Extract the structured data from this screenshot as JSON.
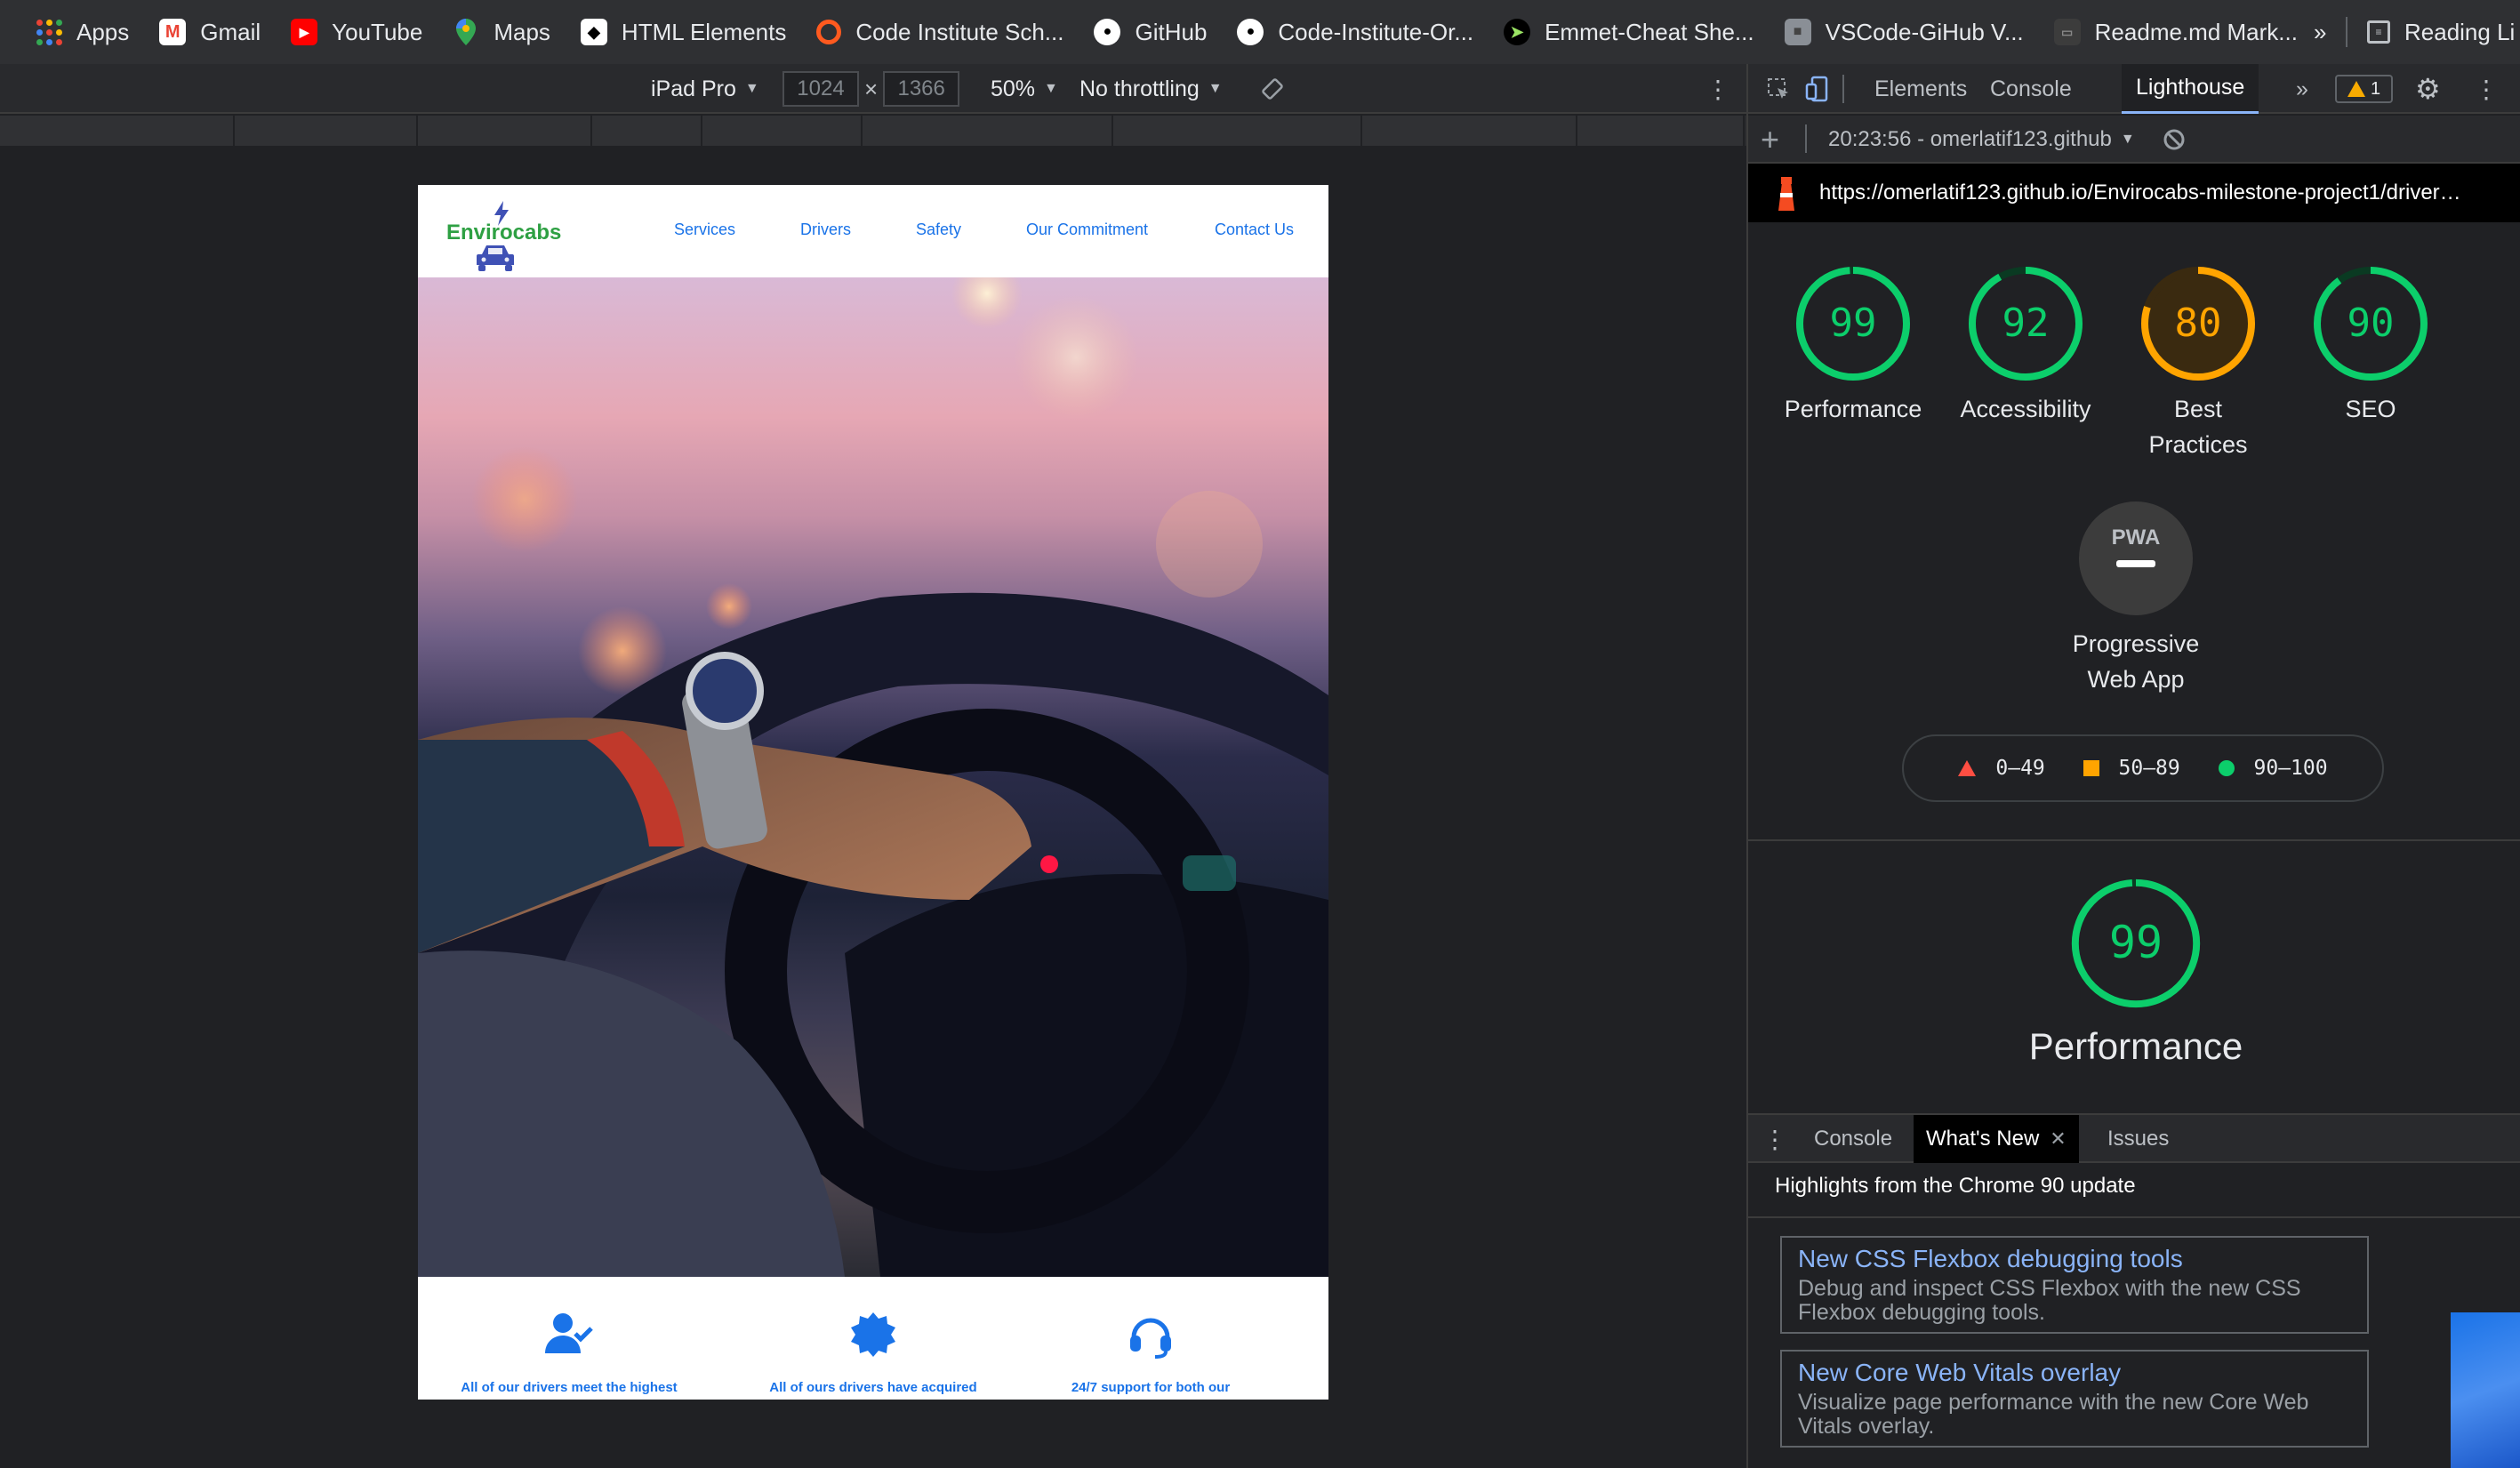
{
  "bookmarks": [
    {
      "label": "Apps",
      "icon": "apps-grid-icon"
    },
    {
      "label": "Gmail",
      "icon": "gmail-icon"
    },
    {
      "label": "YouTube",
      "icon": "youtube-icon"
    },
    {
      "label": "Maps",
      "icon": "maps-icon"
    },
    {
      "label": "HTML Elements",
      "icon": "html-elements-icon"
    },
    {
      "label": "Code Institute Sch...",
      "icon": "code-institute-icon"
    },
    {
      "label": "GitHub",
      "icon": "github-icon"
    },
    {
      "label": "Code-Institute-Or...",
      "icon": "github-icon"
    },
    {
      "label": "Emmet-Cheat She...",
      "icon": "emmet-icon"
    },
    {
      "label": "VSCode-GiHub V...",
      "icon": "vscode-icon"
    },
    {
      "label": "Readme.md Mark...",
      "icon": "readme-icon"
    }
  ],
  "bookmarks_overflow": "»",
  "reading_list": "Reading Li",
  "device_toolbar": {
    "device": "iPad Pro",
    "width": "1024",
    "height": "1366",
    "times": "×",
    "zoom": "50%",
    "throttling": "No throttling"
  },
  "site": {
    "logo_text": "Envirocabs",
    "nav": [
      "Services",
      "Drivers",
      "Safety",
      "Our Commitment",
      "Contact Us"
    ],
    "features": [
      "All of our drivers meet the highest",
      "All of ours drivers have acquired",
      "24/7 support for both our"
    ]
  },
  "devtools": {
    "tabs": [
      "Elements",
      "Console",
      "Lighthouse"
    ],
    "more_tabs": "»",
    "warning_count": "1",
    "report_select": "20:23:56 - omerlatif123.github",
    "url": "https://omerlatif123.github.io/Envirocabs-milestone-project1/driver…",
    "scores": [
      {
        "value": "99",
        "label": "Performance",
        "color": "#0cce6b",
        "fraction": 0.99
      },
      {
        "value": "92",
        "label": "Accessibility",
        "color": "#0cce6b",
        "fraction": 0.92
      },
      {
        "value": "80",
        "label": "Best Practices",
        "color": "#ffa400",
        "fraction": 0.8
      },
      {
        "value": "90",
        "label": "SEO",
        "color": "#0cce6b",
        "fraction": 0.9
      }
    ],
    "pwa": {
      "badge": "PWA",
      "label": "Progressive Web App"
    },
    "legend": [
      "0–49",
      "50–89",
      "90–100"
    ],
    "big_score": {
      "value": "99",
      "label": "Performance",
      "fraction": 0.99
    },
    "drawer": {
      "tabs": [
        "Console",
        "What's New",
        "Issues"
      ],
      "title": "Highlights from the Chrome 90 update",
      "cards": [
        {
          "title": "New CSS Flexbox debugging tools",
          "desc": "Debug and inspect CSS Flexbox with the new CSS Flexbox debugging tools."
        },
        {
          "title": "New Core Web Vitals overlay",
          "desc": "Visualize page performance with the new Core Web Vitals overlay."
        }
      ]
    }
  },
  "colors": {
    "score_green": "#0cce6b",
    "score_orange": "#ffa400",
    "link_blue": "#1a73e8"
  }
}
